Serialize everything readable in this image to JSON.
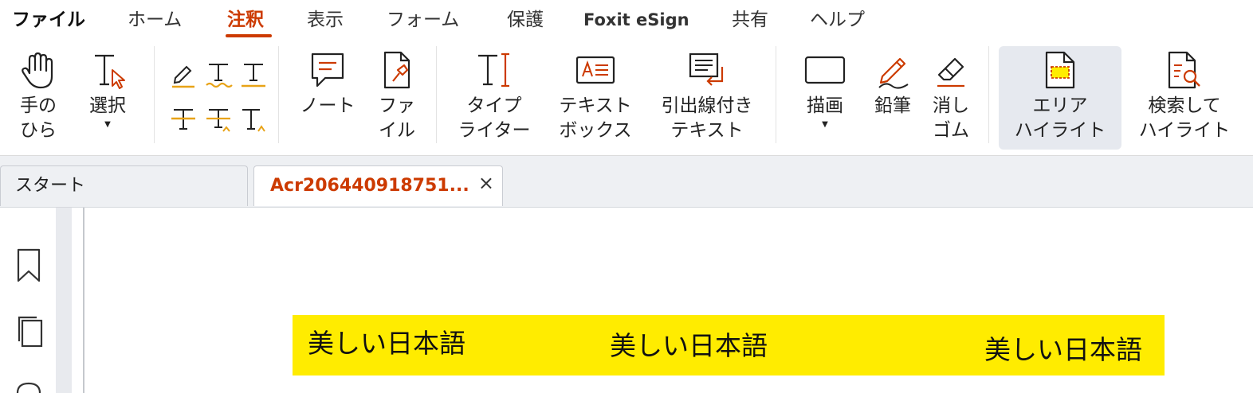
{
  "menubar": {
    "items": [
      {
        "label": "ファイル"
      },
      {
        "label": "ホーム"
      },
      {
        "label": "注釈"
      },
      {
        "label": "表示"
      },
      {
        "label": "フォーム"
      },
      {
        "label": "保護"
      },
      {
        "label": "Foxit eSign"
      },
      {
        "label": "共有"
      },
      {
        "label": "ヘルプ"
      }
    ],
    "active": "注釈"
  },
  "ribbon": {
    "hand": {
      "line1": "手の",
      "line2": "ひら",
      "icon": "hand-icon"
    },
    "select": {
      "line1": "選択",
      "icon": "select-text-icon"
    },
    "note": {
      "line1": "ノート",
      "icon": "note-icon"
    },
    "file": {
      "line1": "ファ",
      "line2": "イル",
      "icon": "file-attachment-icon"
    },
    "typewriter": {
      "line1": "タイプ",
      "line2": "ライター",
      "icon": "typewriter-icon"
    },
    "textbox": {
      "line1": "テキスト",
      "line2": "ボックス",
      "icon": "textbox-icon"
    },
    "callout": {
      "line1": "引出線付き",
      "line2": "テキスト",
      "icon": "callout-icon"
    },
    "draw": {
      "line1": "描画",
      "icon": "rectangle-icon"
    },
    "pencil": {
      "line1": "鉛筆",
      "icon": "pencil-icon"
    },
    "eraser": {
      "line1": "消し",
      "line2": "ゴム",
      "icon": "eraser-icon"
    },
    "area_highlight": {
      "line1": "エリア",
      "line2": "ハイライト",
      "icon": "area-highlight-icon"
    },
    "search_highlight": {
      "line1": "検索して",
      "line2": "ハイライト",
      "icon": "search-highlight-icon"
    }
  },
  "tabs": {
    "start": "スタート",
    "document": "Acr206440918751...",
    "close": "×"
  },
  "document": {
    "text_left": "美しい日本語",
    "text_middle": "美しい日本語",
    "text_right": "美しい日本語"
  },
  "colors": {
    "accent": "#cc3a00",
    "highlight": "#ffec00",
    "icon_orange": "#e8a317"
  }
}
